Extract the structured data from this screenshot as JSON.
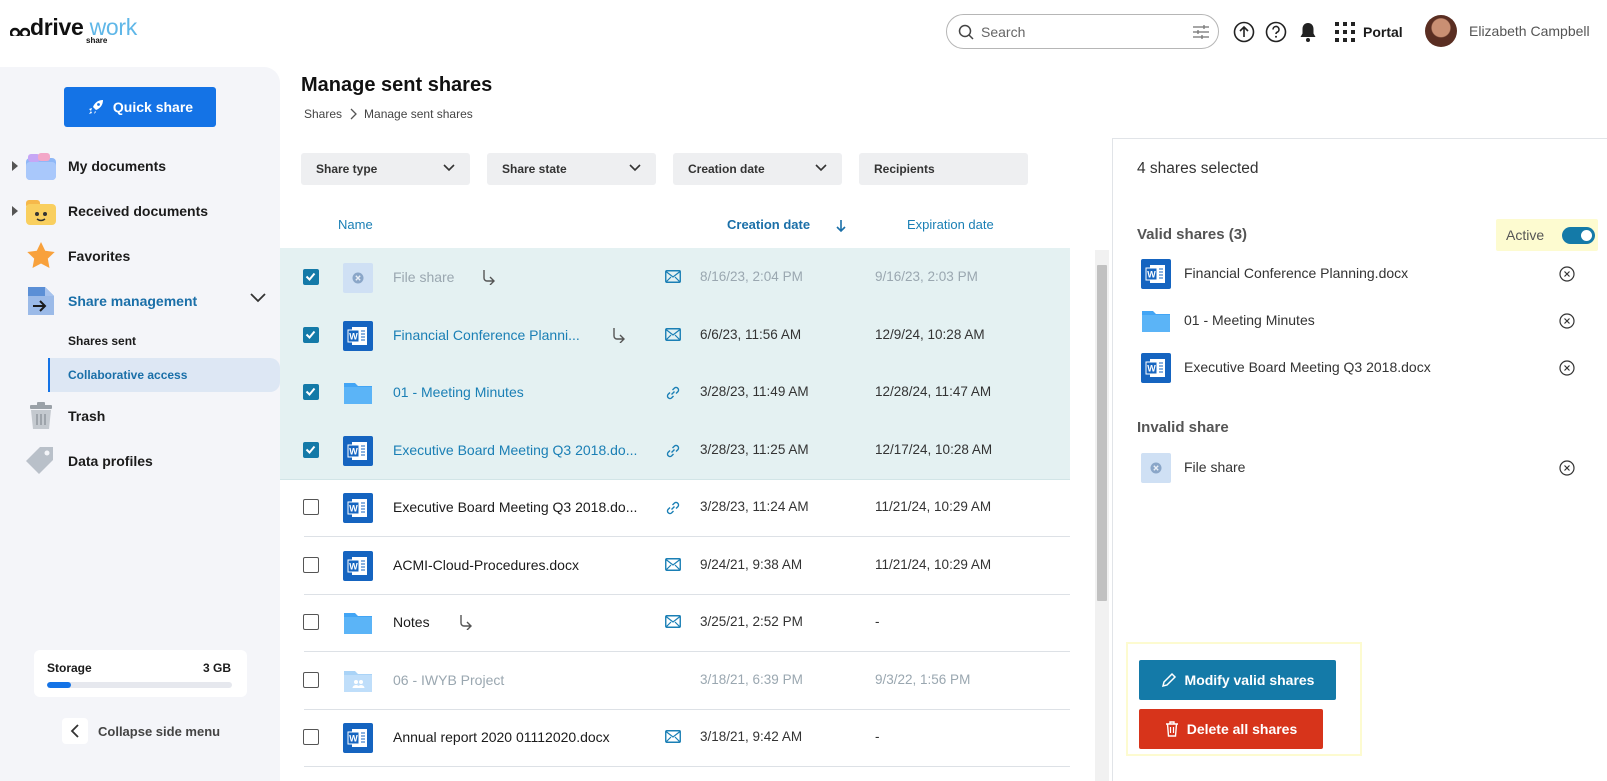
{
  "app": {
    "logo_main": "drive",
    "logo_accent": "work",
    "logo_sub": "share"
  },
  "colors": {
    "primary": "#1473e6",
    "accent": "#147aa8",
    "danger": "#d7341b",
    "selected_row": "#e4f1f2",
    "highlight": "#fdfbd0"
  },
  "header": {
    "search_placeholder": "Search",
    "portal_label": "Portal",
    "user_name": "Elizabeth Campbell",
    "icons": [
      "upload-icon",
      "help-icon",
      "bell-icon",
      "apps-grid-icon"
    ]
  },
  "sidebar": {
    "quick_share": "Quick share",
    "nav": [
      {
        "label": "My documents",
        "icon": "my-documents-icon"
      },
      {
        "label": "Received documents",
        "icon": "received-documents-icon"
      },
      {
        "label": "Favorites",
        "icon": "star-icon"
      },
      {
        "label": "Share management",
        "icon": "share-management-icon"
      },
      {
        "label": "Trash",
        "icon": "trash-icon"
      },
      {
        "label": "Data profiles",
        "icon": "tag-icon"
      }
    ],
    "sub": [
      {
        "label": "Shares sent"
      },
      {
        "label": "Collaborative access"
      }
    ],
    "storage": {
      "label": "Storage",
      "value": "3 GB",
      "used_fraction": 0.13
    },
    "collapse_label": "Collapse side menu"
  },
  "main": {
    "title": "Manage sent shares",
    "breadcrumb": [
      "Shares",
      "Manage sent shares"
    ],
    "filters": [
      "Share type",
      "Share state",
      "Creation date",
      "Recipients"
    ],
    "columns": {
      "name": "Name",
      "creation": "Creation date",
      "expiration": "Expiration date"
    },
    "rows": [
      {
        "name": "File share",
        "created": "8/16/23, 2:04 PM",
        "expires": "9/16/23, 2:03 PM",
        "checked": true,
        "type": "email",
        "kind": "fileshare",
        "fwd": true,
        "dim": true
      },
      {
        "name": "Financial Conference Planni...",
        "created": "6/6/23, 11:56 AM",
        "expires": "12/9/24, 10:28 AM",
        "checked": true,
        "type": "email",
        "kind": "word",
        "fwd": true,
        "dim": false
      },
      {
        "name": "01 - Meeting Minutes",
        "created": "3/28/23, 11:49 AM",
        "expires": "12/28/24, 11:47 AM",
        "checked": true,
        "type": "link",
        "kind": "folder",
        "fwd": false,
        "dim": false
      },
      {
        "name": "Executive Board Meeting Q3 2018.do...",
        "created": "3/28/23, 11:25 AM",
        "expires": "12/17/24, 10:28 AM",
        "checked": true,
        "type": "link",
        "kind": "word",
        "fwd": false,
        "dim": false
      },
      {
        "name": "Executive Board Meeting Q3 2018.do...",
        "created": "3/28/23, 11:24 AM",
        "expires": "11/21/24, 10:29 AM",
        "checked": false,
        "type": "link",
        "kind": "word",
        "fwd": false,
        "dim": false
      },
      {
        "name": "ACMI-Cloud-Procedures.docx",
        "created": "9/24/21, 9:38 AM",
        "expires": "11/21/24, 10:29 AM",
        "checked": false,
        "type": "email",
        "kind": "word",
        "fwd": false,
        "dim": false
      },
      {
        "name": "Notes",
        "created": "3/25/21, 2:52 PM",
        "expires": "-",
        "checked": false,
        "type": "email",
        "kind": "folder",
        "fwd": true,
        "dim": false
      },
      {
        "name": "06 - IWYB Project",
        "created": "3/18/21, 6:39 PM",
        "expires": "9/3/22, 1:56 PM",
        "checked": false,
        "type": "none",
        "kind": "sharedfolder",
        "fwd": false,
        "dim": true
      },
      {
        "name": "Annual report 2020 01112020.docx",
        "created": "3/18/21, 9:42 AM",
        "expires": "-",
        "checked": false,
        "type": "email",
        "kind": "word",
        "fwd": false,
        "dim": false
      }
    ]
  },
  "panel": {
    "count_label": "4 shares selected",
    "valid_title": "Valid shares (3)",
    "active_label": "Active",
    "active_on": true,
    "valid_items": [
      {
        "name": "Financial Conference Planning.docx",
        "kind": "word"
      },
      {
        "name": "01 - Meeting Minutes",
        "kind": "folder"
      },
      {
        "name": "Executive Board Meeting Q3 2018.docx",
        "kind": "word"
      }
    ],
    "invalid_title": "Invalid share",
    "invalid_items": [
      {
        "name": "File share",
        "kind": "fileshare"
      }
    ],
    "modify_label": "Modify valid shares",
    "delete_label": "Delete all shares"
  }
}
